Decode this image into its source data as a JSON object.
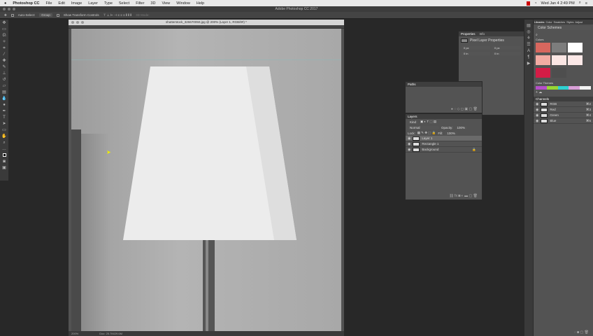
{
  "menubar": {
    "app": "Photoshop CC",
    "items": [
      "File",
      "Edit",
      "Image",
      "Layer",
      "Type",
      "Select",
      "Filter",
      "3D",
      "View",
      "Window",
      "Help"
    ],
    "clock": "Wed Jan 4  2:49 PM"
  },
  "window_title": "Adobe Photoshop CC 2017",
  "options": {
    "auto_select": "Auto-Select:",
    "group": "Group",
    "transform": "Show Transform Controls",
    "mode3d": "3D Mode:"
  },
  "document": {
    "title": "shutterstock_326670050.jpg @ 200% (Layer 1, RGB/8#) *",
    "zoom": "200%",
    "doc_size": "Doc: 25.7M/29.6M"
  },
  "properties": {
    "tabs": [
      "Properties",
      "Info"
    ],
    "title": "Pixel Layer Properties",
    "w": "0 px",
    "h": "0 px",
    "x": "0 in",
    "y": "0 in"
  },
  "paths": {
    "title": "Paths"
  },
  "layers": {
    "title": "Layers",
    "kind": "Kind",
    "blend": "Normal",
    "opacity_label": "Opacity:",
    "opacity": "100%",
    "lock_label": "Lock:",
    "fill_label": "Fill:",
    "fill": "100%",
    "items": [
      {
        "name": "Layer 1"
      },
      {
        "name": "Rectangle 1"
      },
      {
        "name": "Background"
      }
    ]
  },
  "libraries": {
    "tabs": [
      "Libraries",
      "Color",
      "Swatches",
      "Styles",
      "Adjust"
    ],
    "library": "Color Schemes",
    "colors_label": "Colors",
    "themes_label": "Color Themes",
    "swatches": [
      "#d8675e",
      "#7d7d7d",
      "#ffffff",
      "#f3aba3",
      "#fbe6e4",
      "#fbe8e7",
      "#d41c46",
      "#4e4e4e"
    ],
    "theme": [
      "#b44fc8",
      "#98d634",
      "#2fd1d1",
      "#d9a0d8",
      "#f2f2f2"
    ]
  },
  "channels": {
    "title": "Channels",
    "items": [
      {
        "name": "RGB",
        "key": "⌘2"
      },
      {
        "name": "Red",
        "key": "⌘3"
      },
      {
        "name": "Green",
        "key": "⌘4"
      },
      {
        "name": "Blue",
        "key": "⌘5"
      }
    ]
  }
}
